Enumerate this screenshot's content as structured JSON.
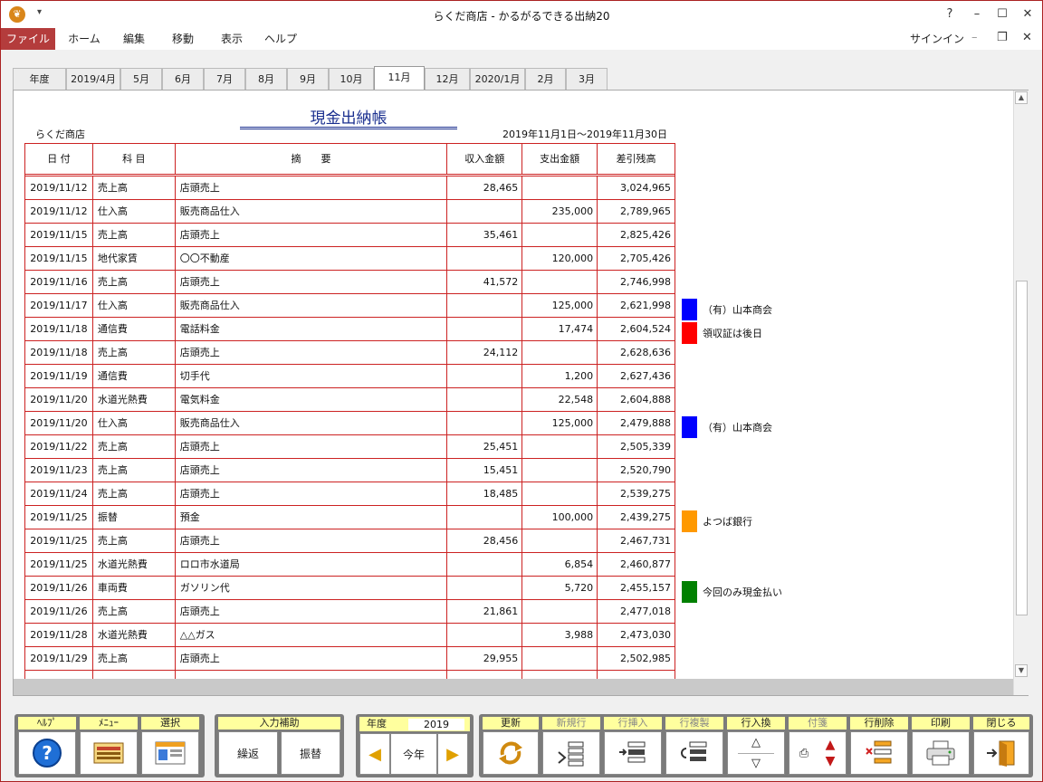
{
  "window": {
    "title": "らくだ商店 - かるがるできる出納20",
    "help_btn": "?"
  },
  "menu": {
    "items": [
      "ファイル",
      "ホーム",
      "編集",
      "移動",
      "表示",
      "ヘルプ"
    ],
    "signin": "サインイン"
  },
  "tabs": [
    {
      "label": "年度"
    },
    {
      "label": "2019/4月"
    },
    {
      "label": "5月"
    },
    {
      "label": "6月"
    },
    {
      "label": "7月"
    },
    {
      "label": "8月"
    },
    {
      "label": "9月"
    },
    {
      "label": "10月"
    },
    {
      "label": "11月"
    },
    {
      "label": "12月"
    },
    {
      "label": "2020/1月"
    },
    {
      "label": "2月"
    },
    {
      "label": "3月"
    }
  ],
  "active_tab": "11月",
  "doc": {
    "title": "現金出納帳",
    "company": "らくだ商店",
    "period": "2019年11月1日～2019年11月30日",
    "headers": [
      "日 付",
      "科 目",
      "摘　　要",
      "収入金額",
      "支出金額",
      "差引残高"
    ]
  },
  "rows": [
    {
      "date": "2019/11/12",
      "acct": "売上高",
      "desc": "店頭売上",
      "inc": "28,465",
      "exp": "",
      "bal": "3,024,965"
    },
    {
      "date": "2019/11/12",
      "acct": "仕入高",
      "desc": "販売商品仕入",
      "inc": "",
      "exp": "235,000",
      "bal": "2,789,965"
    },
    {
      "date": "2019/11/15",
      "acct": "売上高",
      "desc": "店頭売上",
      "inc": "35,461",
      "exp": "",
      "bal": "2,825,426"
    },
    {
      "date": "2019/11/15",
      "acct": "地代家賃",
      "desc": "〇〇不動産",
      "inc": "",
      "exp": "120,000",
      "bal": "2,705,426"
    },
    {
      "date": "2019/11/16",
      "acct": "売上高",
      "desc": "店頭売上",
      "inc": "41,572",
      "exp": "",
      "bal": "2,746,998"
    },
    {
      "date": "2019/11/17",
      "acct": "仕入高",
      "desc": "販売商品仕入",
      "inc": "",
      "exp": "125,000",
      "bal": "2,621,998"
    },
    {
      "date": "2019/11/18",
      "acct": "通信費",
      "desc": "電話料金",
      "inc": "",
      "exp": "17,474",
      "bal": "2,604,524"
    },
    {
      "date": "2019/11/18",
      "acct": "売上高",
      "desc": "店頭売上",
      "inc": "24,112",
      "exp": "",
      "bal": "2,628,636"
    },
    {
      "date": "2019/11/19",
      "acct": "通信費",
      "desc": "切手代",
      "inc": "",
      "exp": "1,200",
      "bal": "2,627,436"
    },
    {
      "date": "2019/11/20",
      "acct": "水道光熱費",
      "desc": "電気料金",
      "inc": "",
      "exp": "22,548",
      "bal": "2,604,888"
    },
    {
      "date": "2019/11/20",
      "acct": "仕入高",
      "desc": "販売商品仕入",
      "inc": "",
      "exp": "125,000",
      "bal": "2,479,888"
    },
    {
      "date": "2019/11/22",
      "acct": "売上高",
      "desc": "店頭売上",
      "inc": "25,451",
      "exp": "",
      "bal": "2,505,339"
    },
    {
      "date": "2019/11/23",
      "acct": "売上高",
      "desc": "店頭売上",
      "inc": "15,451",
      "exp": "",
      "bal": "2,520,790"
    },
    {
      "date": "2019/11/24",
      "acct": "売上高",
      "desc": "店頭売上",
      "inc": "18,485",
      "exp": "",
      "bal": "2,539,275"
    },
    {
      "date": "2019/11/25",
      "acct": "振替",
      "desc": "預金",
      "inc": "",
      "exp": "100,000",
      "bal": "2,439,275"
    },
    {
      "date": "2019/11/25",
      "acct": "売上高",
      "desc": "店頭売上",
      "inc": "28,456",
      "exp": "",
      "bal": "2,467,731"
    },
    {
      "date": "2019/11/25",
      "acct": "水道光熱費",
      "desc": "ロロ市水道局",
      "inc": "",
      "exp": "6,854",
      "bal": "2,460,877"
    },
    {
      "date": "2019/11/26",
      "acct": "車両費",
      "desc": "ガソリン代",
      "inc": "",
      "exp": "5,720",
      "bal": "2,455,157"
    },
    {
      "date": "2019/11/26",
      "acct": "売上高",
      "desc": "店頭売上",
      "inc": "21,861",
      "exp": "",
      "bal": "2,477,018"
    },
    {
      "date": "2019/11/28",
      "acct": "水道光熱費",
      "desc": "△△ガス",
      "inc": "",
      "exp": "3,988",
      "bal": "2,473,030"
    },
    {
      "date": "2019/11/29",
      "acct": "売上高",
      "desc": "店頭売上",
      "inc": "29,955",
      "exp": "",
      "bal": "2,502,985"
    }
  ],
  "memos": [
    {
      "row": 5,
      "color": "#0000ff",
      "text": "（有）山本商会"
    },
    {
      "row": 6,
      "color": "#ff0000",
      "text": "領収証は後日"
    },
    {
      "row": 10,
      "color": "#0000ff",
      "text": "（有）山本商会"
    },
    {
      "row": 14,
      "color": "#ff9900",
      "text": "よつば銀行"
    },
    {
      "row": 17,
      "color": "#008000",
      "text": "今回のみ現金払い"
    }
  ],
  "toolbar": {
    "help": "ﾍﾙﾌﾟ",
    "menu": "ﾒﾆｭｰ",
    "select": "選択",
    "input_assist": "入力補助",
    "repeat": "繰返",
    "transfer": "振替",
    "fiscal_year": "年度",
    "year_value": "2019",
    "this_year": "今年",
    "update": "更新",
    "new_row": "新規行",
    "insert_row": "行挿入",
    "dup_row": "行複製",
    "swap_row": "行入換",
    "tag": "付箋",
    "delete_row": "行削除",
    "print": "印刷",
    "close": "閉じる"
  }
}
